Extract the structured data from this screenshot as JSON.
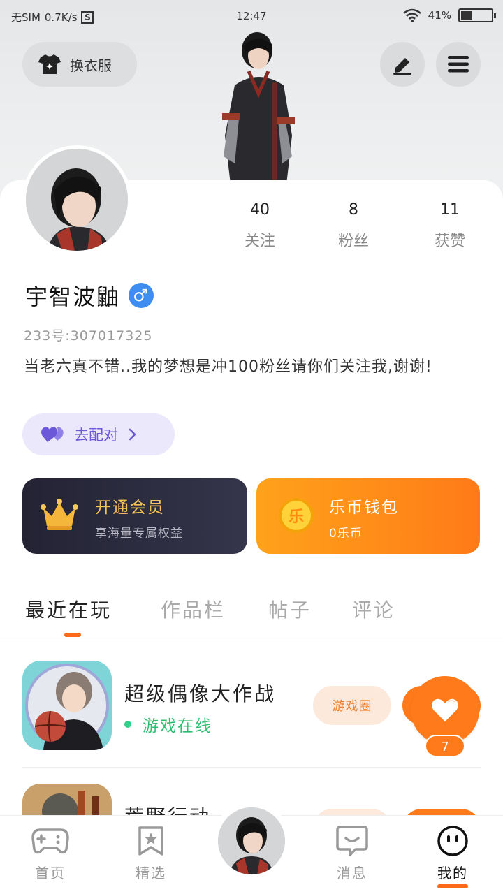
{
  "status_bar": {
    "carrier": "无SIM",
    "speed": "0.7K/s",
    "time": "12:47",
    "battery": "41%"
  },
  "header": {
    "outfit_label": "换衣服"
  },
  "stats": [
    {
      "value": "40",
      "label": "关注"
    },
    {
      "value": "8",
      "label": "粉丝"
    },
    {
      "value": "11",
      "label": "获赞"
    }
  ],
  "profile": {
    "username": "宇智波鼬",
    "gender_symbol": "♂",
    "uid": "233号:307017325",
    "bio": "当老六真不错..我的梦想是冲100粉丝请你们关注我,谢谢!",
    "pair_label": "去配对"
  },
  "vip": {
    "title": "开通会员",
    "subtitle": "享海量专属权益"
  },
  "wallet": {
    "title": "乐币钱包",
    "subtitle": "0乐币",
    "coin_char": "乐"
  },
  "tabs": [
    {
      "label": "最近在玩",
      "active": true
    },
    {
      "label": "作品栏",
      "active": false
    },
    {
      "label": "帖子",
      "active": false
    },
    {
      "label": "评论",
      "active": false
    }
  ],
  "games": [
    {
      "name": "超级偶像大作战",
      "status": "游戏在线",
      "circle_label": "游戏圈"
    },
    {
      "name": "荒野行动",
      "status": "",
      "circle_label": ""
    }
  ],
  "like": {
    "count": "7"
  },
  "bottom_nav": [
    {
      "label": "首页",
      "icon": "gamepad-icon"
    },
    {
      "label": "精选",
      "icon": "star-bookmark-icon"
    },
    {
      "label": "消息",
      "icon": "chat-bubble-icon"
    },
    {
      "label": "我的",
      "icon": "face-icon"
    }
  ],
  "colors": {
    "accent": "#ff7a1a",
    "vip_gold": "#f4c45a",
    "online_green": "#2ec070",
    "pair_purple": "#6a58d8",
    "gender_blue": "#3d8ef0"
  }
}
